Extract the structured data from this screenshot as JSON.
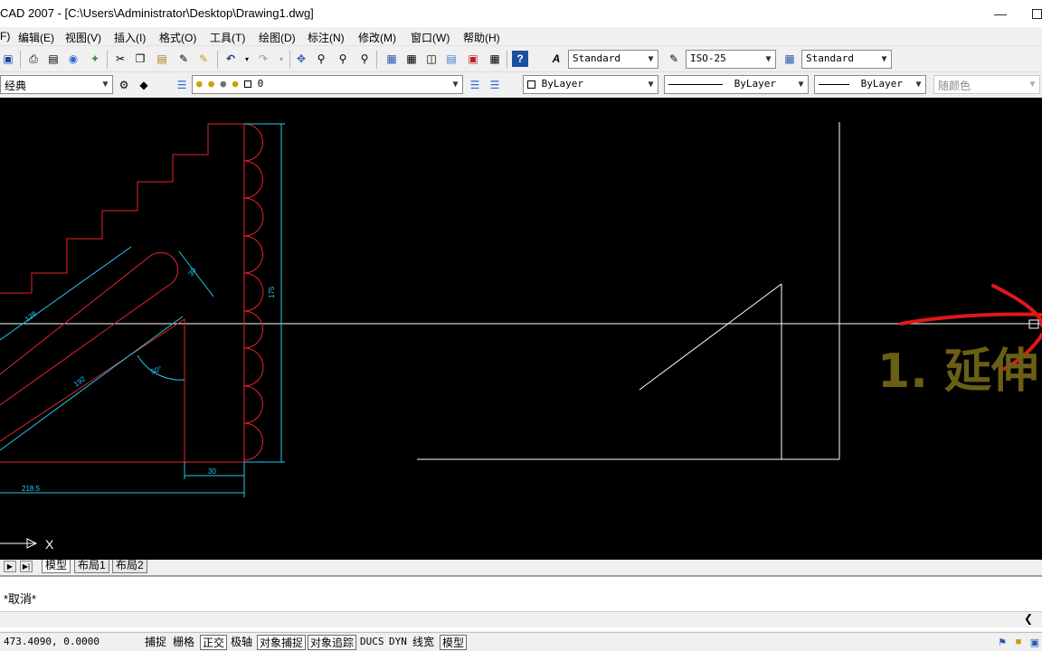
{
  "window": {
    "title": "CAD 2007 - [C:\\Users\\Administrator\\Desktop\\Drawing1.dwg]"
  },
  "menu": [
    {
      "id": "file",
      "label": "F)"
    },
    {
      "id": "edit",
      "label": "编辑(E)"
    },
    {
      "id": "view",
      "label": "视图(V)"
    },
    {
      "id": "insert",
      "label": "插入(I)"
    },
    {
      "id": "format",
      "label": "格式(O)"
    },
    {
      "id": "tools",
      "label": "工具(T)"
    },
    {
      "id": "draw",
      "label": "绘图(D)"
    },
    {
      "id": "dimension",
      "label": "标注(N)"
    },
    {
      "id": "modify",
      "label": "修改(M)"
    },
    {
      "id": "window",
      "label": "窗口(W)"
    },
    {
      "id": "help",
      "label": "帮助(H)"
    }
  ],
  "toolbar": {
    "text_style": "Standard",
    "dim_style": "ISO-25",
    "table_style": "Standard",
    "workspace": "经典",
    "layer": "0",
    "color": "ByLayer",
    "linetype": "ByLayer",
    "lineweight": "ByLayer",
    "plot_style": "随颜色"
  },
  "drawing": {
    "dimensions": [
      "175",
      "30",
      "30",
      "218.5",
      "128",
      "192",
      "50°"
    ],
    "annotation": "1. 延伸",
    "axis_label": "X"
  },
  "tabs": [
    "模型",
    "布局1",
    "布局2"
  ],
  "command": {
    "last_line": "*取消*"
  },
  "status": {
    "coords": "473.4090,  0.0000",
    "buttons": [
      {
        "id": "snap",
        "label": "捕捉",
        "on": false
      },
      {
        "id": "grid",
        "label": "栅格",
        "on": false
      },
      {
        "id": "ortho",
        "label": "正交",
        "on": true
      },
      {
        "id": "polar",
        "label": "极轴",
        "on": false
      },
      {
        "id": "osnap",
        "label": "对象捕捉",
        "on": true
      },
      {
        "id": "otrack",
        "label": "对象追踪",
        "on": true
      },
      {
        "id": "ducs",
        "label": "DUCS",
        "on": false
      },
      {
        "id": "dyn",
        "label": "DYN",
        "on": false
      },
      {
        "id": "lwt",
        "label": "线宽",
        "on": false
      },
      {
        "id": "model",
        "label": "模型",
        "on": true
      }
    ]
  },
  "colors": {
    "canvas": "#000000",
    "geometry_red": "#e8222c",
    "dimension_cyan": "#22c8e8",
    "geometry_white": "#ffffff",
    "annotation_text": "#6a5f14",
    "annotation_stroke": "#e01818"
  }
}
